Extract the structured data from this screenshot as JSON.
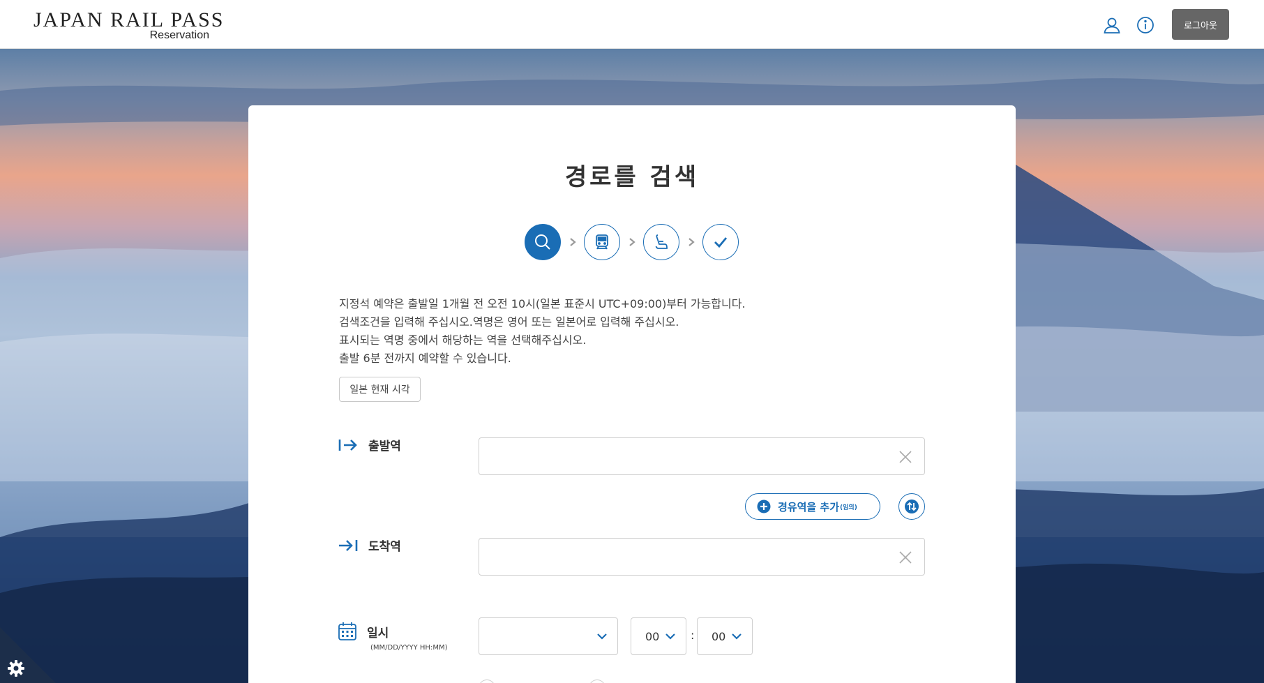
{
  "header": {
    "logo_title": "JAPAN RAIL PASS",
    "logo_subtitle": "Reservation",
    "user_icon": "user-icon",
    "info_icon": "info-icon",
    "logout_label": "로그아웃"
  },
  "main": {
    "title": "경로를 검색",
    "steps": [
      {
        "icon": "search-icon",
        "active": true
      },
      {
        "icon": "train-icon",
        "active": false
      },
      {
        "icon": "seat-icon",
        "active": false
      },
      {
        "icon": "check-icon",
        "active": false
      }
    ],
    "notice": [
      "지정석 예약은 출발일 1개월 전 오전 10시(일본 표준시 UTC+09:00)부터 가능합니다.",
      "검색조건을 입력해 주십시오.역명은 영어 또는 일본어로 입력해 주십시오.",
      "표시되는 역명 중에서 해당하는 역을 선택해주십시오.",
      "출발 6분 전까지 예약할 수 있습니다."
    ],
    "japan_time_button": "일본 현재 시각",
    "departure": {
      "label": "출발역",
      "value": ""
    },
    "via": {
      "label": "경유역을 추가",
      "optional": "(임의)"
    },
    "arrival": {
      "label": "도착역",
      "value": ""
    },
    "datetime": {
      "label": "일시",
      "format_hint": "(MM/DD/YYYY HH:MM)",
      "date_value": "",
      "hour_value": "00",
      "separator": ":",
      "minute_value": "00"
    }
  },
  "colors": {
    "accent": "#1a6db5",
    "logout_bg": "#666666"
  }
}
